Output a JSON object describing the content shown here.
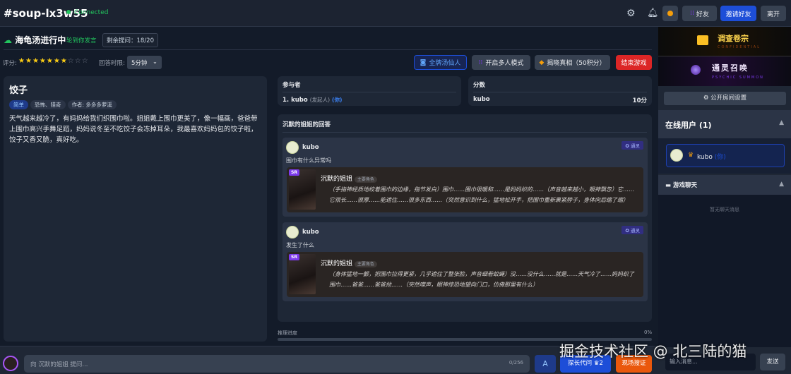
{
  "header": {
    "room": "#soup-lx3w55",
    "status": "Connected",
    "friends": "好友",
    "invite": "邀请好友",
    "leave": "离开"
  },
  "game": {
    "title": "海龟汤进行中",
    "turn": "轮到你发言",
    "remaining": "剩余提问：18/20",
    "rating_label": "评分:",
    "rating": 7,
    "rating_max": 10,
    "time_label": "回答时限:",
    "time_value": "5分钟"
  },
  "actions": {
    "immortal": "全牌汤仙人",
    "multi": "开启多人模式",
    "reveal": "揭晓真相（50积分）",
    "end": "结束游戏"
  },
  "story": {
    "title": "饺子",
    "tags": [
      "简单",
      "恐怖、猎奇",
      "作者: 多多多萝溪"
    ],
    "text": "天气越来越冷了，有妈妈给我们织围巾啦。姐姐戴上围巾更美了，像一幅画，爸爸带上围巾高兴手舞足蹈，妈妈说冬至不吃饺子会冻掉耳朵，我最喜欢妈妈包的饺子啦，饺子又香又脆，真好吃。"
  },
  "participants": {
    "title": "参与者",
    "item": "1. kubo",
    "role": "(发起人)",
    "you": "(你)"
  },
  "scores": {
    "title": "分数",
    "name": "kubo",
    "score": "10分"
  },
  "answers": {
    "title": "沉默的姐姐的回答",
    "items": [
      {
        "user": "kubo",
        "badge": "通灵",
        "question": "围巾有什么异常吗",
        "char": "沉默的姐姐",
        "role": "主要角色",
        "rarity": "SR",
        "reply": "（手指神经质地绞着围巾的边缘，指节发白）围巾……围巾很暖和……是妈妈织的……（声音越来越小，眼神飘忽）它……它很长……很厚……能遮住……很多东西……（突然意识到什么，猛地松开手，把围巾重新裹紧脖子，身体向后缩了缩）"
      },
      {
        "user": "kubo",
        "badge": "通灵",
        "question": "发生了什么",
        "char": "沉默的姐姐",
        "role": "主要角色",
        "rarity": "SR",
        "reply": "（身体猛地一颤，把围巾拉得更紧，几乎遮住了整张脸，声音细若蚊蝇）没……没什么……就是……天气冷了……妈妈织了围巾……爸爸……爸爸他……（突然噤声，眼神惊恐地望向门口，仿佛那里有什么）"
      }
    ]
  },
  "progress": {
    "label": "推理进度",
    "value": "0%",
    "percent": 0
  },
  "input": {
    "placeholder": "向 沉默的姐姐 提问...",
    "counter": "0/256",
    "a_btn": "A",
    "detective": "探长代问",
    "detective_count": "2",
    "scene": "现场搜证"
  },
  "sidebar": {
    "banner1": "调查卷宗",
    "banner1_sub": "CONFIDENTIAL",
    "banner2": "通灵召唤",
    "banner2_sub": "PSYCHIC SUMMON",
    "settings": "公开房间设置",
    "online": "在线用户 (1)",
    "user": "kubo",
    "user_you": "(你)",
    "chat": "游戏聊天",
    "empty": "暂无聊天消息",
    "chat_placeholder": "输入消息...",
    "send": "发送"
  },
  "watermark": "掘金技术社区 @ 北三陆的猫"
}
